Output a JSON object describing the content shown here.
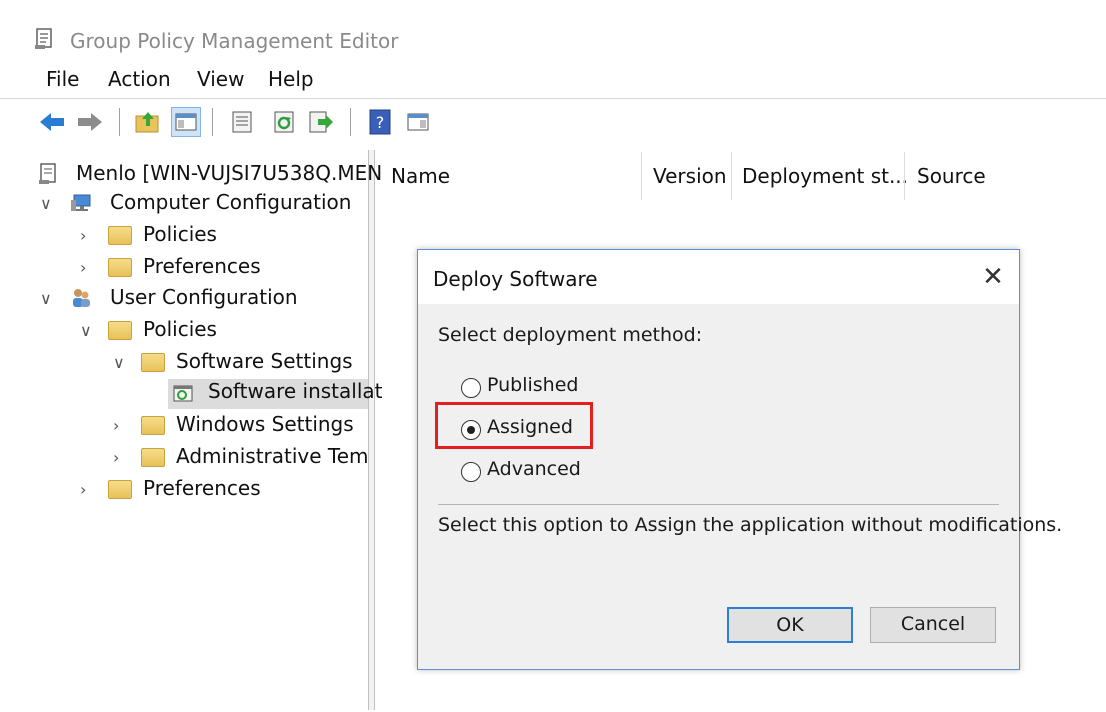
{
  "window": {
    "title": "Group Policy Management Editor",
    "icon": "gpo-editor-icon"
  },
  "menu": {
    "items": [
      "File",
      "Action",
      "View",
      "Help"
    ]
  },
  "toolbar": {
    "icons": [
      "back-arrow-icon",
      "forward-arrow-icon",
      "up-folder-icon",
      "show-hide-tree-icon",
      "properties-icon",
      "refresh-icon",
      "export-list-icon",
      "help-icon",
      "view-pane-icon"
    ]
  },
  "tree": {
    "root": "Menlo [WIN-VUJSI7U538Q.MEN",
    "computer_config": "Computer Configuration",
    "cc_policies": "Policies",
    "cc_preferences": "Preferences",
    "user_config": "User Configuration",
    "uc_policies": "Policies",
    "software_settings": "Software Settings",
    "software_installation": "Software installat",
    "windows_settings": "Windows Settings",
    "admin_templates": "Administrative Temp",
    "uc_preferences": "Preferences",
    "chevrons": {
      "expanded": "∨",
      "collapsed": "›"
    }
  },
  "list": {
    "columns": [
      "Name",
      "Version",
      "Deployment st...",
      "Source"
    ]
  },
  "dialog": {
    "title": "Deploy Software",
    "close_glyph": "✕",
    "method_label": "Select deployment method:",
    "options": [
      {
        "label": "Published",
        "selected": false
      },
      {
        "label": "Assigned",
        "selected": true
      },
      {
        "label": "Advanced",
        "selected": false
      }
    ],
    "description": "Select this option to Assign the application without modifications.",
    "ok_label": "OK",
    "cancel_label": "Cancel"
  },
  "colors": {
    "highlight": "#e32020",
    "dialog_border": "#5b8fd1",
    "ok_focus": "#2d7fd6"
  }
}
